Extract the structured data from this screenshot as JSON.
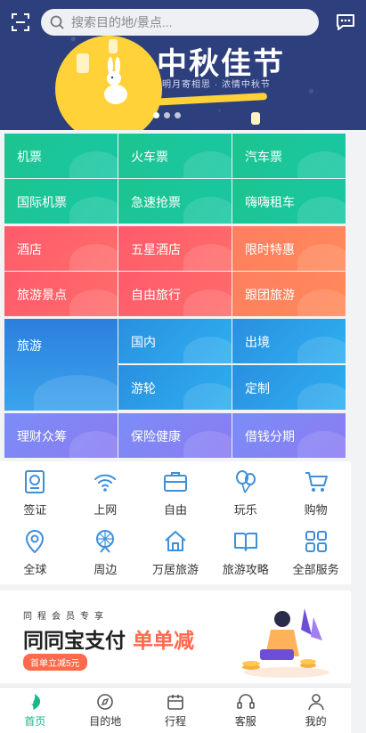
{
  "header": {
    "search_placeholder": "搜索目的地/景点...",
    "scan_icon": "scan-icon",
    "message_icon": "message-icon"
  },
  "banner": {
    "title": "中秋佳节",
    "subtitle": "明月寄相思 · 浓情中秋节",
    "carousel_dots": 3,
    "active_dot": 0
  },
  "grid": {
    "transport": [
      "机票",
      "火车票",
      "汽车票",
      "国际机票",
      "急速抢票",
      "嗨嗨租车"
    ],
    "hotel": [
      "酒店",
      "五星酒店",
      "限时特惠",
      "旅游景点",
      "自由旅行",
      "跟团旅游"
    ],
    "travel": [
      "旅游",
      "国内",
      "出境",
      "游轮",
      "定制"
    ],
    "finance": [
      "理财众筹",
      "保险健康",
      "借钱分期"
    ]
  },
  "services": [
    {
      "label": "签证",
      "icon": "visa-icon"
    },
    {
      "label": "上网",
      "icon": "wifi-icon"
    },
    {
      "label": "自由",
      "icon": "briefcase-icon"
    },
    {
      "label": "玩乐",
      "icon": "balloon-icon"
    },
    {
      "label": "购物",
      "icon": "cart-icon"
    },
    {
      "label": "全球",
      "icon": "location-icon"
    },
    {
      "label": "周边",
      "icon": "ferris-wheel-icon"
    },
    {
      "label": "万居旅游",
      "icon": "house-icon"
    },
    {
      "label": "旅游攻略",
      "icon": "book-icon"
    },
    {
      "label": "全部服务",
      "icon": "grid-icon"
    }
  ],
  "ad": {
    "small": "同程会员专享",
    "title_main": "同同宝支付",
    "title_highlight": "单单减",
    "badge": "首单立减5元"
  },
  "tabbar": [
    {
      "label": "首页",
      "icon": "home-icon",
      "active": true
    },
    {
      "label": "目的地",
      "icon": "compass-icon",
      "active": false
    },
    {
      "label": "行程",
      "icon": "calendar-icon",
      "active": false
    },
    {
      "label": "客服",
      "icon": "headset-icon",
      "active": false
    },
    {
      "label": "我的",
      "icon": "user-icon",
      "active": false
    }
  ],
  "colors": {
    "accent": "#18b88a",
    "banner_bg": "#2d3f7c",
    "moon": "#ffd23a",
    "icon_blue": "#3f8fd8",
    "ad_highlight": "#ff6a4a"
  }
}
